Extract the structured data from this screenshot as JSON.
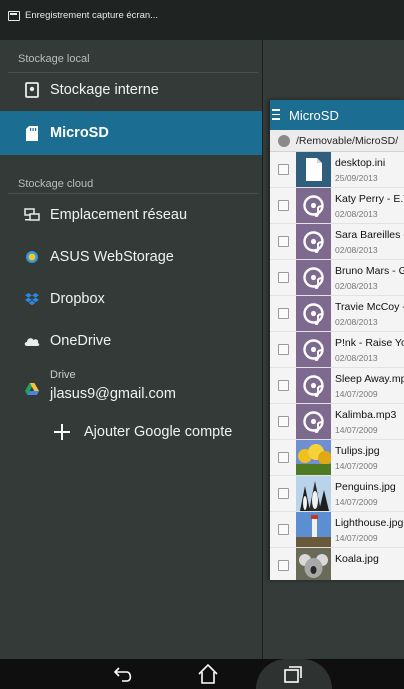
{
  "status_bar": {
    "notification": "Enregistrement capture écran..."
  },
  "drawer": {
    "local_section": "Stockage local",
    "local_items": [
      {
        "label": "Stockage interne",
        "icon": "phone-storage-icon"
      },
      {
        "label": "MicroSD",
        "icon": "sd-card-icon",
        "active": true
      }
    ],
    "cloud_section": "Stockage cloud",
    "cloud_items": [
      {
        "label": "Emplacement réseau",
        "icon": "network-icon"
      },
      {
        "label": "ASUS WebStorage",
        "icon": "asus-webstorage-icon"
      },
      {
        "label": "Dropbox",
        "icon": "dropbox-icon"
      },
      {
        "label": "OneDrive",
        "icon": "onedrive-icon"
      }
    ],
    "drive": {
      "label": "Drive",
      "account": "jlasus9@gmail.com",
      "icon": "google-drive-icon"
    },
    "add_google": "Ajouter Google compte"
  },
  "file_panel": {
    "title": "MicroSD",
    "path": "/Removable/MicroSD/",
    "files": [
      {
        "name": "desktop.ini",
        "date": "25/09/2013",
        "type": "doc"
      },
      {
        "name": "Katy Perry - E.T",
        "date": "02/08/2013",
        "type": "music"
      },
      {
        "name": "Sara Bareilles -",
        "date": "02/08/2013",
        "type": "music"
      },
      {
        "name": "Bruno Mars - Gi",
        "date": "02/08/2013",
        "type": "music"
      },
      {
        "name": "Travie McCoy -",
        "date": "02/08/2013",
        "type": "music"
      },
      {
        "name": "P!nk - Raise Yo",
        "date": "02/08/2013",
        "type": "music"
      },
      {
        "name": "Sleep Away.mp",
        "date": "14/07/2009",
        "type": "music"
      },
      {
        "name": "Kalimba.mp3",
        "date": "14/07/2009",
        "type": "music"
      },
      {
        "name": "Tulips.jpg",
        "date": "14/07/2009",
        "type": "image-tulips"
      },
      {
        "name": "Penguins.jpg",
        "date": "14/07/2009",
        "type": "image-penguins"
      },
      {
        "name": "Lighthouse.jpg",
        "date": "14/07/2009",
        "type": "image-lighthouse"
      },
      {
        "name": "Koala.jpg",
        "date": "",
        "type": "image-koala"
      }
    ]
  },
  "colors": {
    "accent": "#1b6e91",
    "music_thumb": "#7e6a8f",
    "drawer_bg": "#343a38"
  }
}
